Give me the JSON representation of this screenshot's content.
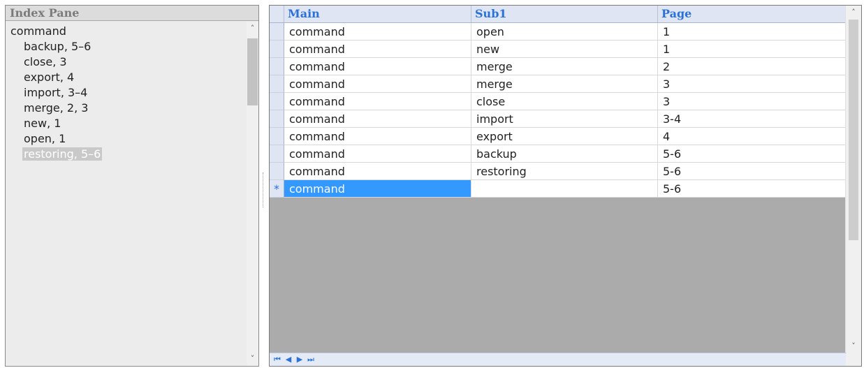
{
  "index_pane": {
    "title": "Index Pane",
    "root": "command",
    "items": [
      "backup, 5–6",
      "close, 3",
      "export, 4",
      "import, 3–4",
      "merge, 2, 3",
      "new, 1",
      "open, 1",
      "restoring, 5–6"
    ],
    "selected_item": "restoring, 5–6"
  },
  "grid": {
    "columns": [
      "Main",
      "Sub1",
      "Page"
    ],
    "rows": [
      {
        "main": "command",
        "sub1": "open",
        "page": "1"
      },
      {
        "main": "command",
        "sub1": "new",
        "page": "1"
      },
      {
        "main": "command",
        "sub1": "merge",
        "page": "2"
      },
      {
        "main": "command",
        "sub1": "merge",
        "page": "3"
      },
      {
        "main": "command",
        "sub1": "close",
        "page": "3"
      },
      {
        "main": "command",
        "sub1": "import",
        "page": "3-4"
      },
      {
        "main": "command",
        "sub1": "export",
        "page": "4"
      },
      {
        "main": "command",
        "sub1": "backup",
        "page": "5-6"
      },
      {
        "main": "command",
        "sub1": "restoring",
        "page": "5-6"
      }
    ],
    "new_row": {
      "marker": "*",
      "main": "command",
      "sub1": "",
      "page": "5-6"
    },
    "nav_buttons": [
      "first-record",
      "previous-record",
      "next-record",
      "last-record"
    ]
  },
  "colors": {
    "accent": "#2a72d8",
    "selection": "#3399ff",
    "grid_empty": "#ababab",
    "header_bg": "#dfe5f3"
  },
  "icons": {
    "scroll_up": "chevron-up-icon",
    "scroll_down": "chevron-down-icon",
    "nav_first": "first-record-icon",
    "nav_prev": "previous-record-icon",
    "nav_next": "next-record-icon",
    "nav_last": "last-record-icon"
  }
}
